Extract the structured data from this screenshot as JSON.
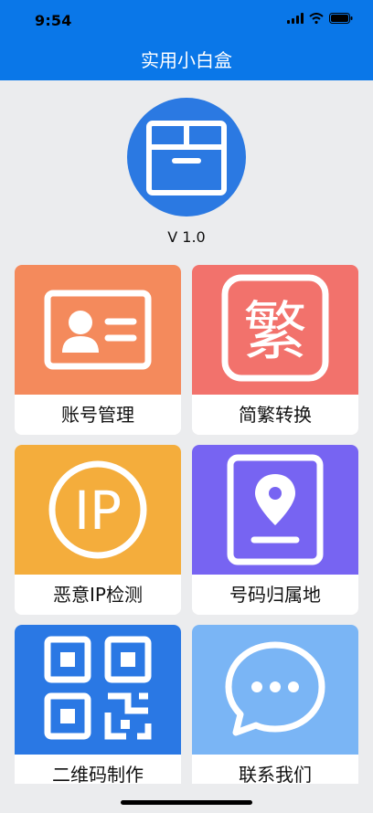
{
  "status": {
    "time": "9:54"
  },
  "nav": {
    "title": "实用小白盒"
  },
  "app": {
    "version": "V 1.0"
  },
  "cards": [
    {
      "label": "账号管理",
      "icon": "id-card-icon",
      "color": "#f48a5c"
    },
    {
      "label": "简繁转换",
      "icon": "traditional-char-icon",
      "glyph": "繁",
      "color": "#f2726c"
    },
    {
      "label": "恶意IP检测",
      "icon": "ip-icon",
      "glyph": "IP",
      "color": "#f4ad3c"
    },
    {
      "label": "号码归属地",
      "icon": "location-book-icon",
      "color": "#7764f2"
    },
    {
      "label": "二维码制作",
      "icon": "qr-code-icon",
      "color": "#2a78e4"
    },
    {
      "label": "联系我们",
      "icon": "chat-bubble-icon",
      "color": "#7ab5f5"
    }
  ],
  "colors": {
    "nav": "#0a77e8",
    "background": "#ebecee"
  }
}
